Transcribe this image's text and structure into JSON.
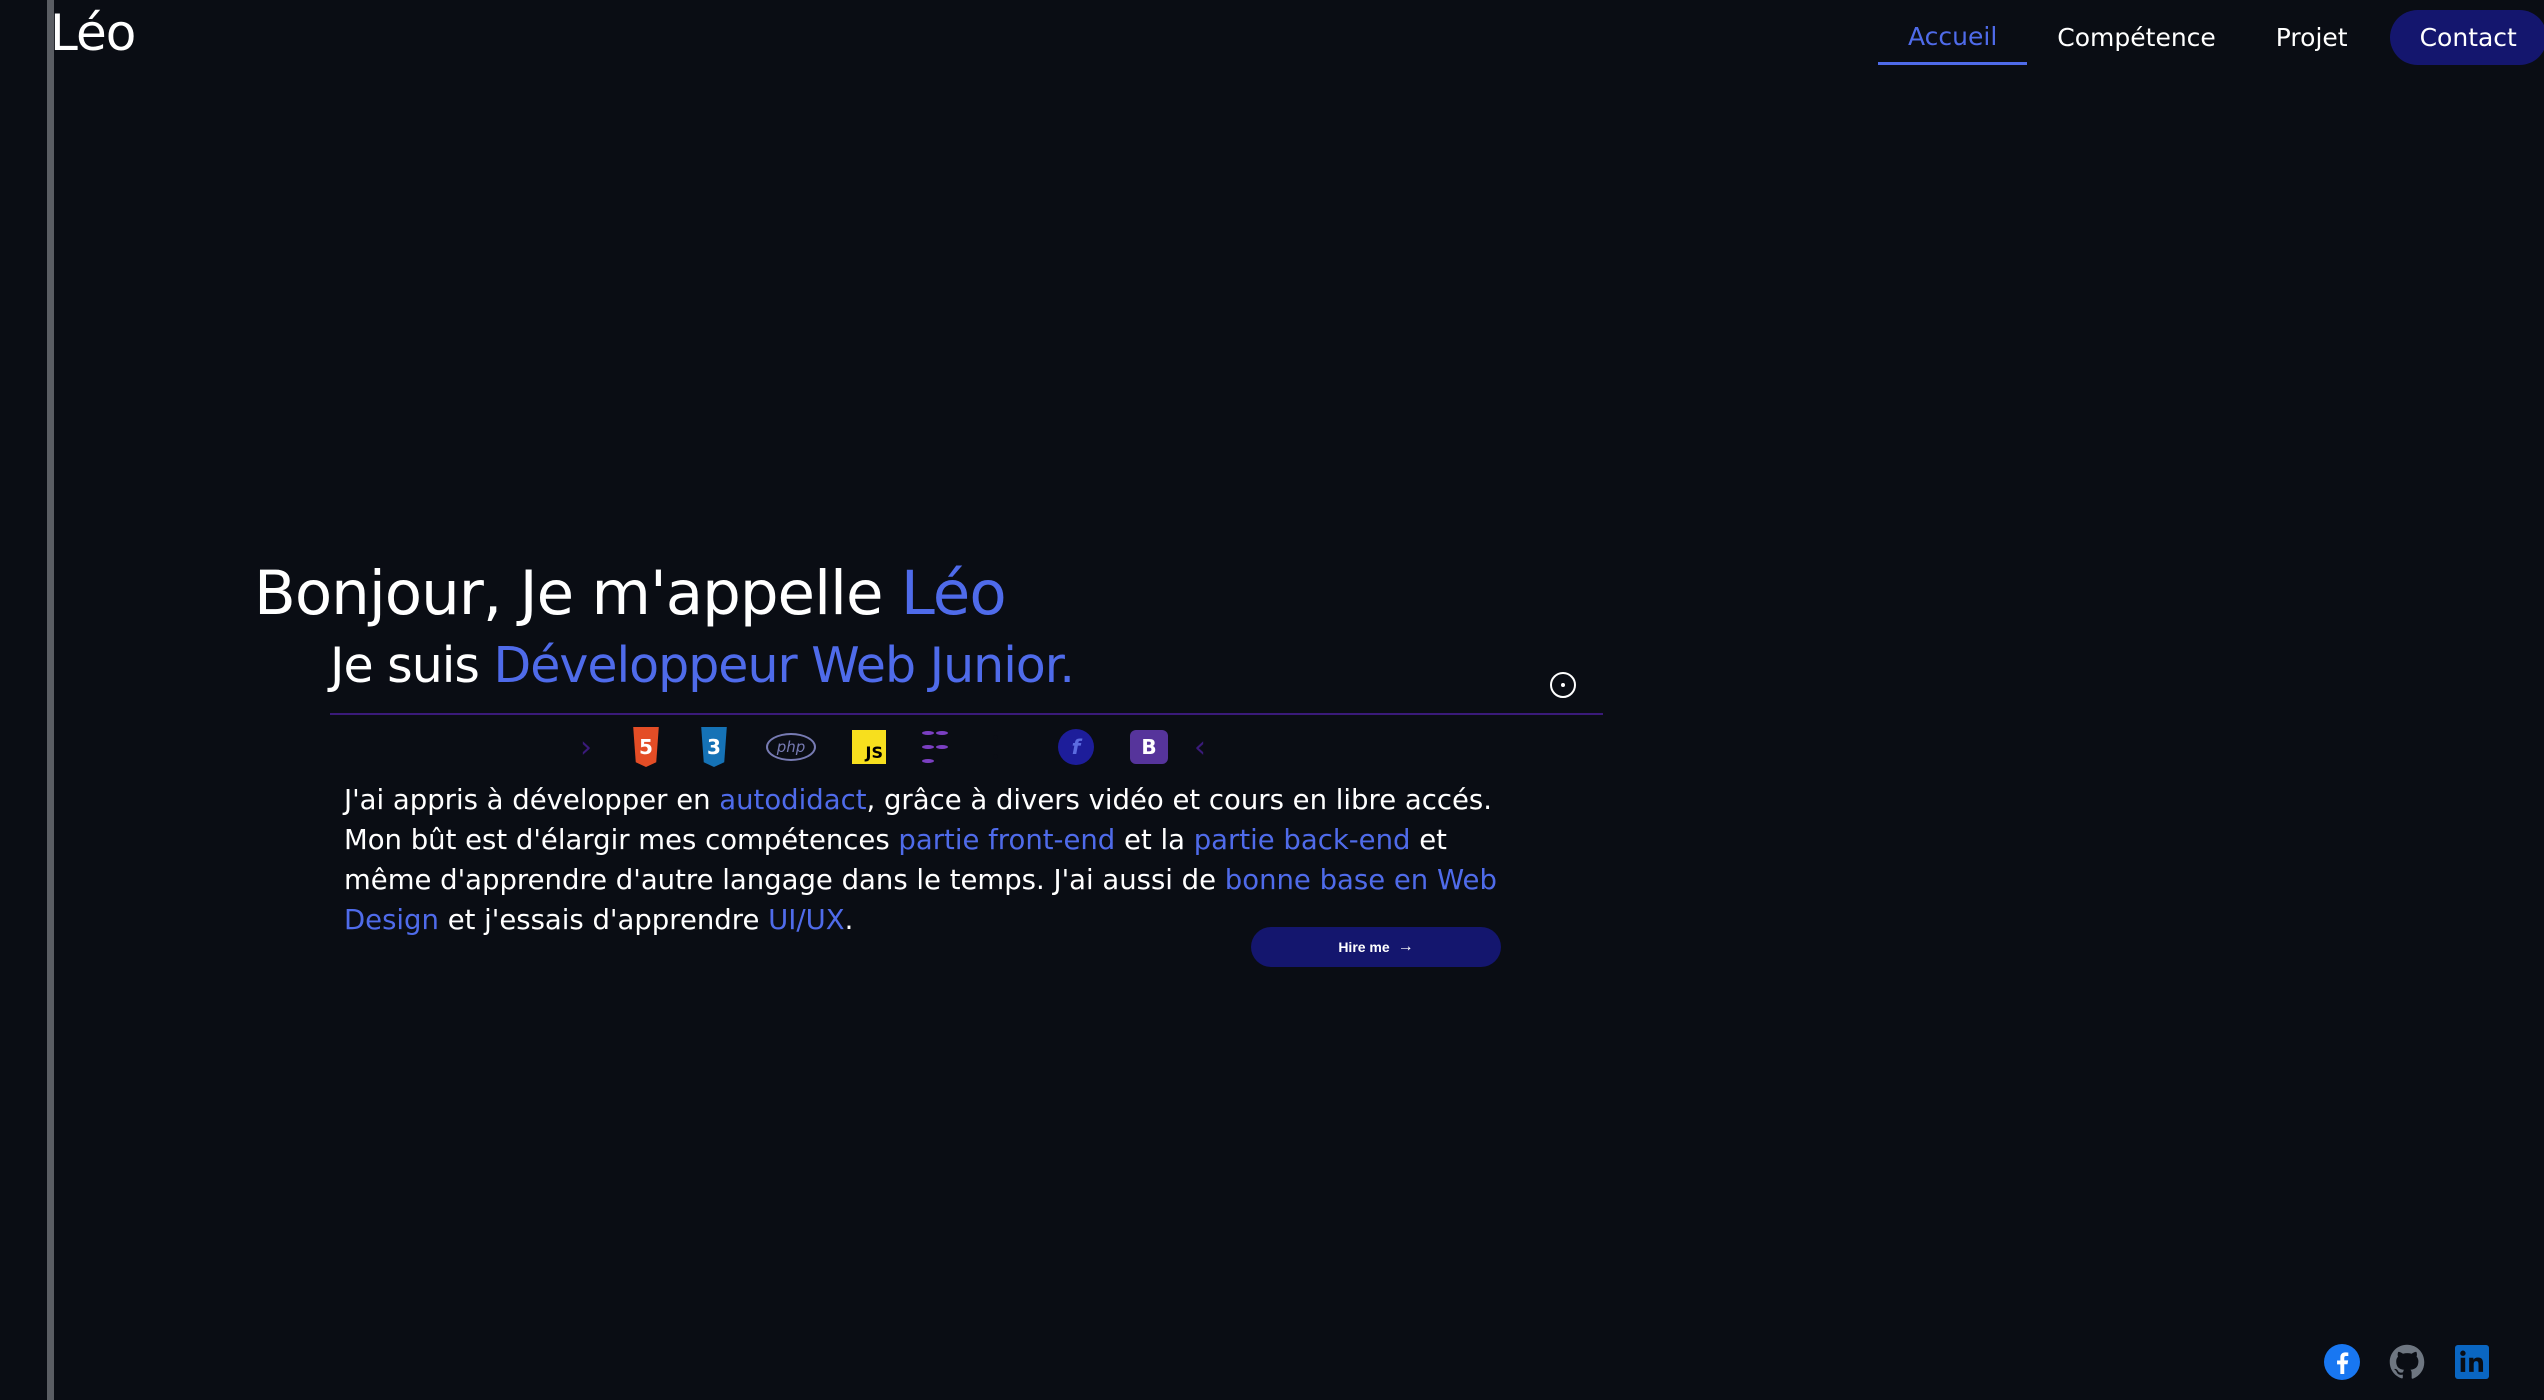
{
  "header": {
    "logo": "Léo",
    "nav": [
      {
        "label": "Accueil",
        "active": true
      },
      {
        "label": "Compétence",
        "active": false
      },
      {
        "label": "Projet",
        "active": false
      },
      {
        "label": "Contact",
        "active": false
      }
    ]
  },
  "hero": {
    "greeting": "Bonjour, Je m'appelle ",
    "name": "Léo",
    "intro": "Je suis ",
    "role": "Développeur Web Junior."
  },
  "tech_icons": [
    "html5-icon",
    "css3-icon",
    "php-icon",
    "javascript-icon",
    "figma-icon",
    "database-icon",
    "symfony-icon",
    "bootstrap-icon"
  ],
  "tech_labels": {
    "php": "php",
    "js": "JS",
    "html": "5",
    "css": "3",
    "symfony": "f",
    "bootstrap": "B"
  },
  "paragraph": {
    "p1": "J'ai appris à développer en ",
    "h1": "autodidact",
    "p2": ", grâce à divers vidéo et cours en libre accés. Mon bût est d'élargir mes compétences ",
    "h2": "partie front-end",
    "p3": " et la ",
    "h3": "partie back-end",
    "p4": " et même d'apprendre d'autre langage dans le temps. J'ai aussi de ",
    "h4": "bonne base en Web Design",
    "p5": " et j'essais d'apprendre ",
    "h5": "UI/UX",
    "p6": "."
  },
  "cta": {
    "label": "Hire me"
  },
  "social": [
    "facebook-icon",
    "github-icon",
    "linkedin-icon"
  ],
  "colors": {
    "background": "#0a0d14",
    "accent": "#4f6bea",
    "button": "#14166e",
    "divider": "#3a1a7a"
  }
}
